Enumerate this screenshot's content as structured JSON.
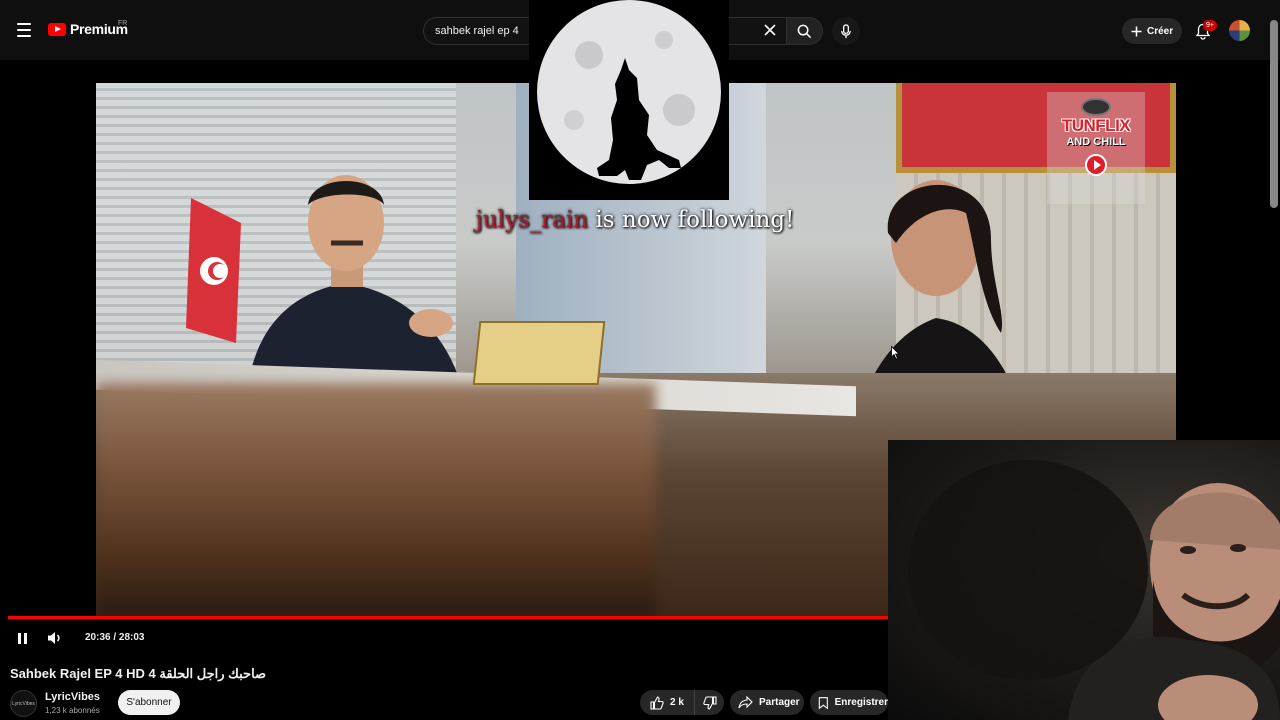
{
  "header": {
    "brand": "Premium",
    "country_code": "FR",
    "search_value": "sahbek rajel ep 4",
    "create_label": "Créer",
    "notification_badge": "9+"
  },
  "overlay": {
    "follower_name": "julys_rain",
    "follow_message": " is now following!",
    "watermark_line1": "TUNFLIX",
    "watermark_line2": "AND CHILL"
  },
  "player": {
    "current_time": "20:36",
    "duration": "28:03",
    "time_display": "20:36 / 28:03",
    "progress_fraction": 0.7338,
    "state": "playing"
  },
  "video": {
    "title": "Sahbek Rajel EP 4 HD 4 صاحبك راجل الحلقة",
    "channel_name": "LyricVibes",
    "channel_avatar_text": "LyricVibes",
    "subscribers": "1,23 k abonnés",
    "subscribe_label": "S'abonner",
    "like_count": "2 k",
    "share_label": "Partager",
    "save_label": "Enregistrer"
  },
  "colors": {
    "accent": "#ff0000",
    "follower_name": "#a91c2d",
    "background": "#0f0f0f"
  },
  "icons": [
    "menu-icon",
    "youtube-logo-icon",
    "clear-icon",
    "search-icon",
    "mic-icon",
    "plus-icon",
    "bell-icon",
    "pause-icon",
    "volume-icon",
    "like-icon",
    "dislike-icon",
    "share-icon",
    "bookmark-icon"
  ]
}
